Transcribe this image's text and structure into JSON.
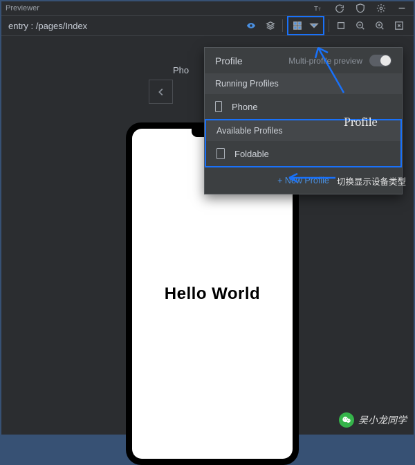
{
  "titlebar": {
    "title": "Previewer"
  },
  "pathbar": {
    "path": "entry : /pages/Index"
  },
  "device": {
    "label": "Pho",
    "content": "Hello World"
  },
  "panel": {
    "title": "Profile",
    "mp_label": "Multi-profile preview",
    "running_header": "Running Profiles",
    "running_item": "Phone",
    "available_header": "Available Profiles",
    "available_item": "Foldable",
    "new_profile": "+ New Profile"
  },
  "annotations": {
    "profile_text": "Profile",
    "switch_text": "切换显示设备类型"
  },
  "watermark": {
    "text": "吴小龙同学"
  }
}
